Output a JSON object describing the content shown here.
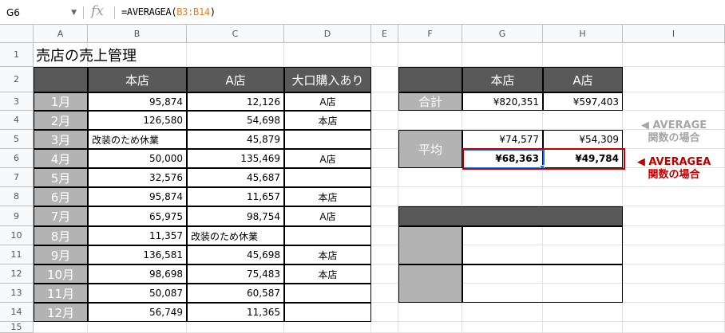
{
  "formula_bar": {
    "name_box": "G6",
    "fx": "fx",
    "formula_prefix": "=AVERAGEA(",
    "formula_range": "B3:B14",
    "formula_suffix": ")"
  },
  "columns": [
    "A",
    "B",
    "C",
    "D",
    "E",
    "F",
    "G",
    "H",
    "I"
  ],
  "rows": [
    "1",
    "2",
    "3",
    "4",
    "5",
    "6",
    "7",
    "8",
    "9",
    "10",
    "11",
    "12",
    "13",
    "14",
    "15"
  ],
  "left_table": {
    "title": "売店の売上管理",
    "headers": [
      "本店",
      "A店",
      "大口購入あり"
    ],
    "months": [
      "1月",
      "2月",
      "3月",
      "4月",
      "5月",
      "6月",
      "7月",
      "8月",
      "9月",
      "10月",
      "11月",
      "12月"
    ],
    "main": [
      "95,874",
      "126,580",
      "改装のため休業",
      "50,000",
      "32,576",
      "95,874",
      "65,975",
      "11,357",
      "136,581",
      "98,698",
      "50,087",
      "56,749"
    ],
    "a_store": [
      "12,126",
      "54,698",
      "45,879",
      "135,469",
      "45,687",
      "11,657",
      "98,754",
      "改装のため休業",
      "45,698",
      "75,483",
      "60,587",
      "11,365"
    ],
    "bulk": [
      "A店",
      "本店",
      "",
      "A店",
      "",
      "本店",
      "A店",
      "",
      "本店",
      "本店",
      "",
      ""
    ]
  },
  "right_table": {
    "headers": [
      "本店",
      "A店"
    ],
    "total_label": "合計",
    "total_main": "¥820,351",
    "total_a": "¥597,403",
    "avg_label": "平均",
    "avg_main": "¥74,577",
    "avg_a": "¥54,309",
    "avga_main": "¥68,363",
    "avga_a": "¥49,784"
  },
  "notes": {
    "average": "◀ AVERAGE\n関数の場合",
    "averagea": "◀ AVERAGEA\n関数の場合"
  },
  "colors": {
    "dark_header": "#595959",
    "month_fill": "#b3b3b3",
    "selection": "#1a73e8",
    "highlight_red": "#c00000",
    "formula_ref": "#e67c28"
  }
}
